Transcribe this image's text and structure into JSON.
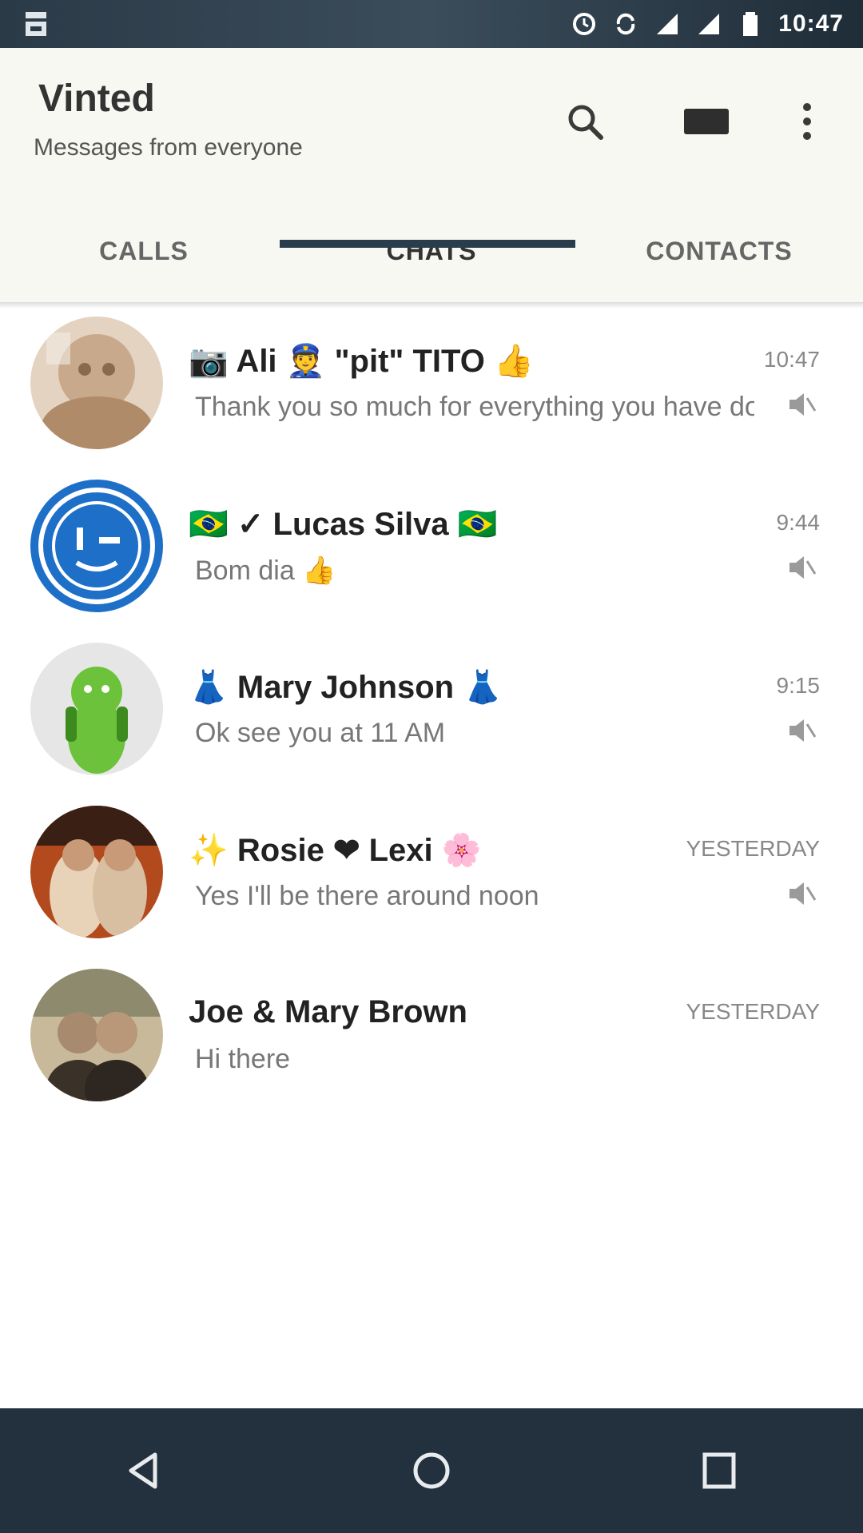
{
  "status_bar": {
    "time": "10:47"
  },
  "app_bar": {
    "title": "Vinted",
    "subtitle": "Messages from everyone",
    "icons": [
      "search-icon",
      "new-chat-icon",
      "overflow-menu-icon"
    ]
  },
  "tabs": [
    {
      "label": "CALLS"
    },
    {
      "label": "CHATS"
    },
    {
      "label": "CONTACTS"
    }
  ],
  "chats": [
    {
      "name": "📷 Ali 👮 \"pit\" TITO 👍",
      "message": "Thank you so much for everything you have done",
      "time": "10:47",
      "avatar_colors": [
        "#c9a98b",
        "#e4d3c0",
        "#8a6a4f"
      ],
      "muted": true
    },
    {
      "name": "🇧🇷 ✓ Lucas Silva 🇧🇷",
      "message": "Bom dia 👍",
      "time": "9:44",
      "avatar_colors": [
        "#1e6fc8",
        "#ffffff",
        "#1e6fc8"
      ],
      "muted": true
    },
    {
      "name": "👗 Mary Johnson 👗",
      "message": "Ok see you at 11 AM",
      "time": "9:15",
      "avatar_colors": [
        "#dcdcdc",
        "#6cc23a",
        "#3d8a1f"
      ],
      "muted": true
    },
    {
      "name": "✨ Rosie ❤ Lexi 🌸",
      "message": "Yes I'll be there around noon",
      "time": "YESTERDAY",
      "avatar_colors": [
        "#b34a1d",
        "#e8d2b8",
        "#3a2014"
      ],
      "muted": true
    },
    {
      "name": "Joe & Mary Brown",
      "message": "Hi there",
      "time": "YESTERDAY",
      "avatar_colors": [
        "#8d8a6e",
        "#c7b99a",
        "#3a3228"
      ],
      "muted": false
    }
  ],
  "nav_bar": {
    "icons": [
      "back-icon",
      "home-icon",
      "recents-icon"
    ]
  },
  "colors": {
    "status_bar": "#2b3a47",
    "app_bar": "#f8f8f2",
    "tab_indicator": "#2a3d4c",
    "nav_bar": "#22313d"
  }
}
